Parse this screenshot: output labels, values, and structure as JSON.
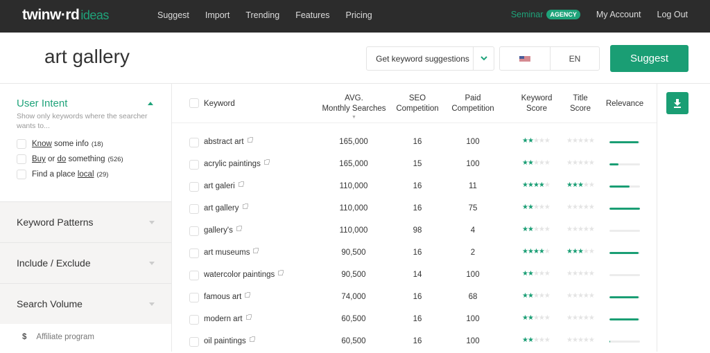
{
  "topbar": {
    "logo_main": "twinw·rd",
    "logo_sub": "ideas",
    "nav": [
      "Suggest",
      "Import",
      "Trending",
      "Features",
      "Pricing"
    ],
    "account_name": "Seminar",
    "account_badge": "AGENCY",
    "my_account": "My Account",
    "logout": "Log Out"
  },
  "header": {
    "query": "art gallery",
    "mode_select": "Get keyword suggestions",
    "country_flag": "us-flag-icon",
    "language": "EN",
    "suggest_button": "Suggest"
  },
  "sidebar": {
    "user_intent": {
      "title": "User Intent",
      "description": "Show only keywords where the searcher wants to...",
      "options": [
        {
          "parts": [
            {
              "u": "Know"
            },
            {
              "t": " some info"
            }
          ],
          "count": "(18)"
        },
        {
          "parts": [
            {
              "u": "Buy"
            },
            {
              "t": " or "
            },
            {
              "u": "do"
            },
            {
              "t": " something"
            }
          ],
          "count": "(526)"
        },
        {
          "parts": [
            {
              "t": "Find a place "
            },
            {
              "u": "local"
            }
          ],
          "count": "(29)"
        }
      ]
    },
    "sections": [
      "Keyword Patterns",
      "Include / Exclude",
      "Search Volume"
    ],
    "affiliate_icon": "$",
    "affiliate_label": "Affiliate program"
  },
  "table": {
    "headers": {
      "keyword": "Keyword",
      "avg_line1": "AVG.",
      "avg_line2": "Monthly Searches",
      "seo_line1": "SEO",
      "seo_line2": "Competition",
      "paid_line1": "Paid",
      "paid_line2": "Competition",
      "kscore_line1": "Keyword",
      "kscore_line2": "Score",
      "tscore_line1": "Title",
      "tscore_line2": "Score",
      "relevance": "Relevance",
      "sort_indicator": "▼"
    },
    "rows": [
      {
        "keyword": "abstract art",
        "searches": "165,000",
        "seo": "16",
        "paid": "100",
        "keyword_score": 2,
        "title_score": 0,
        "relevance": 0.95
      },
      {
        "keyword": "acrylic paintings",
        "searches": "165,000",
        "seo": "15",
        "paid": "100",
        "keyword_score": 2,
        "title_score": 0,
        "relevance": 0.3
      },
      {
        "keyword": "art galeri",
        "searches": "110,000",
        "seo": "16",
        "paid": "11",
        "keyword_score": 4,
        "title_score": 3,
        "relevance": 0.65
      },
      {
        "keyword": "art gallery",
        "searches": "110,000",
        "seo": "16",
        "paid": "75",
        "keyword_score": 2,
        "title_score": 0,
        "relevance": 1.0
      },
      {
        "keyword": "gallery's",
        "searches": "110,000",
        "seo": "98",
        "paid": "4",
        "keyword_score": 2,
        "title_score": 0,
        "relevance": 0.0
      },
      {
        "keyword": "art museums",
        "searches": "90,500",
        "seo": "16",
        "paid": "2",
        "keyword_score": 4,
        "title_score": 3,
        "relevance": 0.95
      },
      {
        "keyword": "watercolor paintings",
        "searches": "90,500",
        "seo": "14",
        "paid": "100",
        "keyword_score": 2,
        "title_score": 0,
        "relevance": 0.0
      },
      {
        "keyword": "famous art",
        "searches": "74,000",
        "seo": "16",
        "paid": "68",
        "keyword_score": 2,
        "title_score": 0,
        "relevance": 0.95
      },
      {
        "keyword": "modern art",
        "searches": "60,500",
        "seo": "16",
        "paid": "100",
        "keyword_score": 2,
        "title_score": 0,
        "relevance": 0.95
      },
      {
        "keyword": "oil paintings",
        "searches": "60,500",
        "seo": "16",
        "paid": "100",
        "keyword_score": 2,
        "title_score": 0,
        "relevance": 0.02
      }
    ],
    "download_icon": "download-icon"
  },
  "colors": {
    "brand_green": "#1a9e74",
    "topbar_bg": "#2c2c2c",
    "sidebar_section_bg": "#f5f4f3"
  }
}
